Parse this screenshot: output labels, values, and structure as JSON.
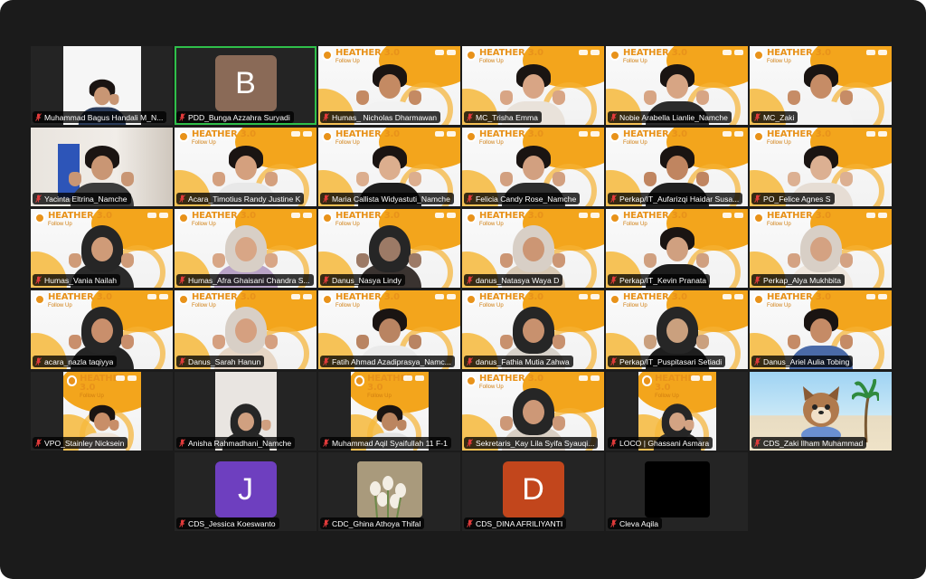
{
  "participants": [
    {
      "name": "Muhammad Bagus Handali M_N...",
      "kind": "smallcam",
      "skin": "#c89674",
      "shirt": "#2a3b5a",
      "hair": "hair"
    },
    {
      "name": "PDD_Bunga Azzahra Suryadi",
      "kind": "avatar",
      "initial": "B",
      "color": "#8a6a57",
      "active": true
    },
    {
      "name": "Humas_ Nicholas Dharmawan",
      "kind": "heather",
      "skin": "#c48a63",
      "shirt": "#f2f2f2",
      "hair": "hair"
    },
    {
      "name": "MC_Trisha Emma",
      "kind": "heather",
      "skin": "#d8a585",
      "shirt": "#e9e2da",
      "hair": "hair"
    },
    {
      "name": "Nobie Arabella Lianlie_Namche",
      "kind": "heather",
      "skin": "#d7a584",
      "shirt": "#2b2b2b",
      "hair": "hair"
    },
    {
      "name": "MC_Zaki",
      "kind": "heather",
      "skin": "#c68c66",
      "shirt": "#f4f4f4",
      "hair": "hair"
    },
    {
      "name": "Yacinta Eltrina_Namche",
      "kind": "room",
      "skin": "#c99674",
      "shirt": "#3c3c3c",
      "hair": "hair"
    },
    {
      "name": "Acara_Timotius Randy Justine K",
      "kind": "heather",
      "skin": "#d4a07e",
      "shirt": "#e8e8e8",
      "hair": "hair"
    },
    {
      "name": "Maria Callista Widyastuti_Namche",
      "kind": "heather",
      "skin": "#dcae8e",
      "shirt": "#1d1d1d",
      "hair": "hair"
    },
    {
      "name": "Felicia Candy Rose_Namche",
      "kind": "heather",
      "skin": "#d2a080",
      "shirt": "#2d2d2d",
      "hair": "hair"
    },
    {
      "name": "Perkap/IT_Aufarizqi Haidar Susa...",
      "kind": "heather",
      "skin": "#c08560",
      "shirt": "#202020",
      "hair": "hair"
    },
    {
      "name": "PO_Felice Agnes S",
      "kind": "heather",
      "skin": "#dcb092",
      "shirt": "#e6ddd4",
      "hair": "hair"
    },
    {
      "name": "Humas_Vania Nailah",
      "kind": "heather",
      "skin": "#cf9b78",
      "shirt": "#2a2a2a",
      "hair": "hijab"
    },
    {
      "name": "Humas_Afra Ghaisani Chandra S...",
      "kind": "heather",
      "skin": "#d8a686",
      "shirt": "#b9a3c7",
      "hair": "hijab-light"
    },
    {
      "name": "Danus_Nasya Lindy",
      "kind": "heather",
      "skin": "#9c7a66",
      "shirt": "#3a3330",
      "hair": "hijab"
    },
    {
      "name": "danus_Natasya Waya D",
      "kind": "heather",
      "skin": "#cc9674",
      "shirt": "#d9c9b4",
      "hair": "hijab-light"
    },
    {
      "name": "Perkap/IT_Kevin Pranata",
      "kind": "heather",
      "skin": "#d0a080",
      "shirt": "#1c1c1c",
      "hair": "hair"
    },
    {
      "name": "Perkap_Alya Mukhbita",
      "kind": "heather",
      "skin": "#d4a282",
      "shirt": "#efe6dc",
      "hair": "hijab-light"
    },
    {
      "name": "acara_nazla taqiyya",
      "kind": "heather",
      "skin": "#c98f6c",
      "shirt": "#242424",
      "hair": "hijab"
    },
    {
      "name": "Danus_Sarah Hanun",
      "kind": "heather",
      "skin": "#d5a080",
      "shirt": "#e7d6c5",
      "hair": "hijab-light"
    },
    {
      "name": "Fatih Ahmad Azadiprasya_Namc...",
      "kind": "heather",
      "skin": "#b98462",
      "shirt": "#eaeaea",
      "hair": "hair"
    },
    {
      "name": "danus_Fathia Mutia Zahwa",
      "kind": "heather",
      "skin": "#c8916e",
      "shirt": "#d8d2ca",
      "hair": "hijab"
    },
    {
      "name": "Perkap/IT_Puspitasari Setiadi",
      "kind": "heather",
      "skin": "#caa07e",
      "shirt": "#1e1e1e",
      "hair": "hijab"
    },
    {
      "name": "Danus_Ariel Aulia Tobing",
      "kind": "heather",
      "skin": "#c58b66",
      "shirt": "#4a6aa8",
      "hair": "hair"
    },
    {
      "name": "VPO_Stainley Nicksein",
      "kind": "smallcam",
      "skin": "#c88e68",
      "shirt": "#efe4d8",
      "hair": "hair",
      "heather": true
    },
    {
      "name": "Anisha Rahmadhani_Namche",
      "kind": "smallcam",
      "skin": "#d0a080",
      "shirt": "#2a2a2a",
      "hair": "hijab",
      "plain": true
    },
    {
      "name": "Muhammad Aqil Syaifullah 11 F-1",
      "kind": "smallcam",
      "skin": "#bb8560",
      "shirt": "#e2e2e2",
      "hair": "hair",
      "heather": true
    },
    {
      "name": "Sekretaris_Kay Lila Syifa Syauqi...",
      "kind": "heather",
      "skin": "#cd9877",
      "shirt": "#d9cfc4",
      "hair": "hijab"
    },
    {
      "name": "LOCO | Ghassani Asmara",
      "kind": "smallcam",
      "skin": "#d3a383",
      "shirt": "#2c2c2c",
      "hair": "hijab",
      "heather": true
    },
    {
      "name": "CDS_Zaki Ilham Muhammad",
      "kind": "beach"
    }
  ],
  "last_row": [
    {
      "name": "CDS_Jessica Koeswanto",
      "kind": "avatar",
      "initial": "J",
      "color": "#6e3fbf"
    },
    {
      "name": "CDC_Ghina Athoya Thifal",
      "kind": "tulips"
    },
    {
      "name": "CDS_DINA AFRILIYANTI",
      "kind": "avatar",
      "initial": "D",
      "color": "#c2461c"
    },
    {
      "name": "Cleva Aqila",
      "kind": "black"
    }
  ],
  "banner": {
    "title": "HEATHER 3.0",
    "subtitle": "Follow Up"
  },
  "colors": {
    "background": "#1b1b1b",
    "active_speaker": "#2fbf4a",
    "brand_orange": "#e8921a",
    "muted_mic": "#e23b3b"
  },
  "icons": {
    "muted": "muted-mic-icon"
  }
}
